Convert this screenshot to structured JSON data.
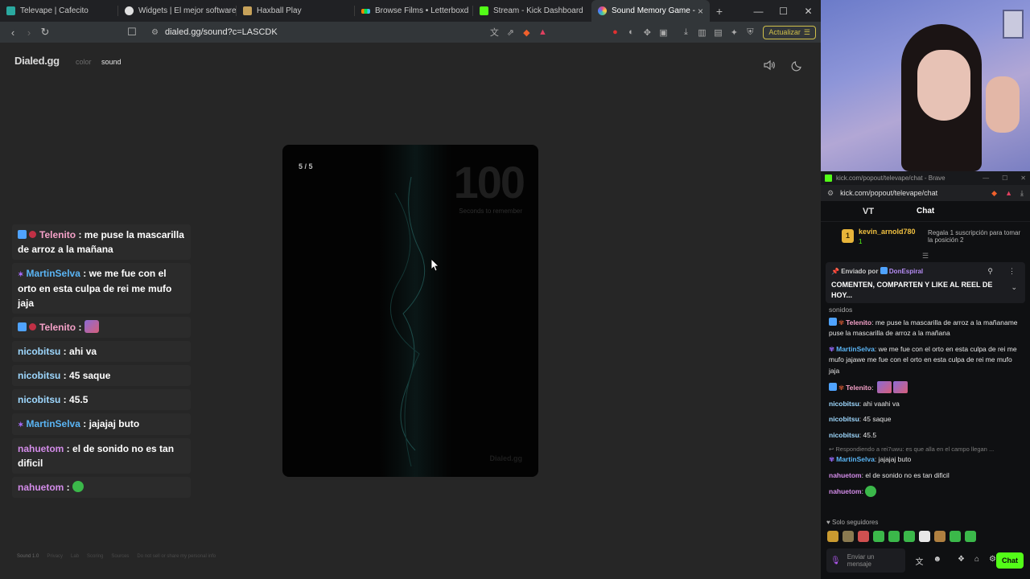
{
  "browser": {
    "tabs": [
      {
        "title": "Televape | Cafecito",
        "favicon_color": "#2aa9a0"
      },
      {
        "title": "Widgets | El mejor software par",
        "favicon_color": "#e0e0e0"
      },
      {
        "title": "Haxball Play",
        "favicon_color": "#c7a25a"
      },
      {
        "title": "Browse Films • Letterboxd",
        "favicon_color": "#40bcf4"
      },
      {
        "title": "Stream - Kick Dashboard",
        "favicon_color": "#53fc18"
      },
      {
        "title": "Sound Memory Game -",
        "favicon_color": "#e5468a"
      }
    ],
    "new_tab": "+",
    "url": "dialed.gg/sound?c=LASCDK",
    "update_label": "Actualizar"
  },
  "site": {
    "logo": "Dialed.gg",
    "nav_color": "color",
    "nav_sound": "sound",
    "card": {
      "counter": "5 / 5",
      "big_number": "100",
      "subtitle": "Seconds to remember",
      "watermark": "Dialed.gg"
    },
    "footer": [
      "Sound 1.0",
      "Privacy",
      "Lab",
      "Scoring",
      "Sources",
      "Do not sell or share my personal info"
    ]
  },
  "overlay_chat": [
    {
      "user": "Telenito",
      "text": "me puse la mascarilla de arroz a la mañana",
      "color_class": "n-pink",
      "badges": true
    },
    {
      "user": "MartinSelva",
      "text": "we me fue con el orto en esta culpa de rei me mufo jaja",
      "color_class": "n-blue",
      "star": true
    },
    {
      "user": "Telenito",
      "text": "",
      "color_class": "n-pink",
      "badges": true,
      "emote": true
    },
    {
      "user": "nicobitsu",
      "text": "ahi va",
      "color_class": "n-cyan"
    },
    {
      "user": "nicobitsu",
      "text": "45 saque",
      "color_class": "n-cyan"
    },
    {
      "user": "nicobitsu",
      "text": "45.5",
      "color_class": "n-cyan"
    },
    {
      "user": "MartinSelva",
      "text": "jajajaj buto",
      "color_class": "n-blue",
      "star": true
    },
    {
      "user": "nahuetom",
      "text": "el de sonido no es tan dificil",
      "color_class": "n-orchid"
    },
    {
      "user": "nahuetom",
      "text": "",
      "color_class": "n-orchid",
      "green_emote": true
    }
  ],
  "kick": {
    "window_title": "kick.com/popout/televape/chat - Brave",
    "url": "kick.com/popout/televape/chat",
    "logo_text": "VT",
    "chat_title": "Chat",
    "gift": {
      "rank": "1",
      "user": "kevin_arnold780",
      "count": "1",
      "promo": "Regala 1 suscripción para tomar la posición 2"
    },
    "pinned": {
      "label": "Enviado por",
      "user": "DonEspiral",
      "text": "COMENTEN, COMPARTEN Y LIKE AL REEL DE HOY..."
    },
    "cut_line": "sonidos",
    "messages": [
      {
        "user": "Telenito",
        "user_color": "#f5a1c8",
        "text": "me puse la mascarilla de arroz a la mañaname puse la mascarilla de arroz a la mañana"
      },
      {
        "user": "MartinSelva",
        "user_color": "#5ab5f5",
        "text": "we me fue con el orto en esta culpa de rei me mufo jajawe me fue con el orto en esta culpa de rei me mufo jaja"
      },
      {
        "user": "Telenito",
        "user_color": "#f5a1c8",
        "text": ""
      },
      {
        "user": "nicobitsu",
        "user_color": "#9ed8ff",
        "text": "ahi vaahi va"
      },
      {
        "user": "nicobitsu",
        "user_color": "#9ed8ff",
        "text": "45 saque"
      },
      {
        "user": "nicobitsu",
        "user_color": "#9ed8ff",
        "text": "45.5"
      }
    ],
    "reply_note": "Respondiendo a rei7uwu: es que alla en el campo llegan ...",
    "messages2": [
      {
        "user": "MartinSelva",
        "user_color": "#5ab5f5",
        "text": "jajajaj buto"
      },
      {
        "user": "nahuetom",
        "user_color": "#d38ce9",
        "text": "el de sonido no es tan dificil"
      },
      {
        "user": "nahuetom",
        "user_color": "#d38ce9",
        "text": ""
      }
    ],
    "followers_only": "Solo seguidores",
    "input_placeholder": "Enviar un mensaje",
    "chat_button": "Chat"
  }
}
